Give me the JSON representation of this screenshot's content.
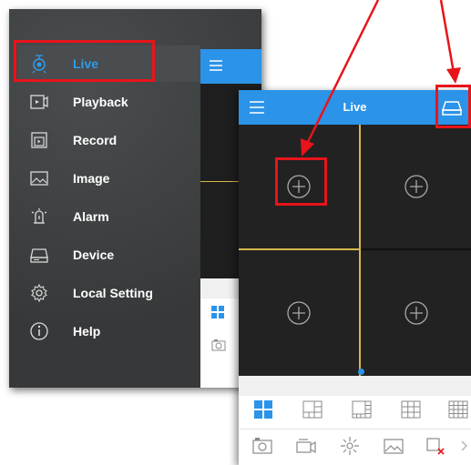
{
  "drawer": {
    "items": [
      {
        "label": "Live",
        "icon": "camera-icon",
        "active": true
      },
      {
        "label": "Playback",
        "icon": "playback-icon",
        "active": false
      },
      {
        "label": "Record",
        "icon": "record-icon",
        "active": false
      },
      {
        "label": "Image",
        "icon": "image-icon",
        "active": false
      },
      {
        "label": "Alarm",
        "icon": "alarm-icon",
        "active": false
      },
      {
        "label": "Device",
        "icon": "device-icon",
        "active": false
      },
      {
        "label": "Local Setting",
        "icon": "gear-icon",
        "active": false
      },
      {
        "label": "Help",
        "icon": "help-icon",
        "active": false
      }
    ]
  },
  "live": {
    "title": "Live",
    "menu_icon": "hamburger-menu-icon",
    "device_icon": "device-list-icon",
    "cells": [
      {
        "icon": "add-channel-icon"
      },
      {
        "icon": "add-channel-icon"
      },
      {
        "icon": "add-channel-icon"
      },
      {
        "icon": "add-channel-icon"
      }
    ],
    "layouts": [
      "layout-1x1-icon",
      "layout-1plus5-icon",
      "layout-1plus7-icon",
      "layout-3x3-icon",
      "layout-4x4-icon"
    ],
    "tools": [
      "snapshot-icon",
      "record-video-icon",
      "ptz-icon",
      "image-icon",
      "close-all-icon",
      "chevron-right-icon"
    ]
  },
  "colors": {
    "accent": "#2b93e8",
    "annotation": "#e8141a",
    "grid_divider": "#d8b84c"
  }
}
